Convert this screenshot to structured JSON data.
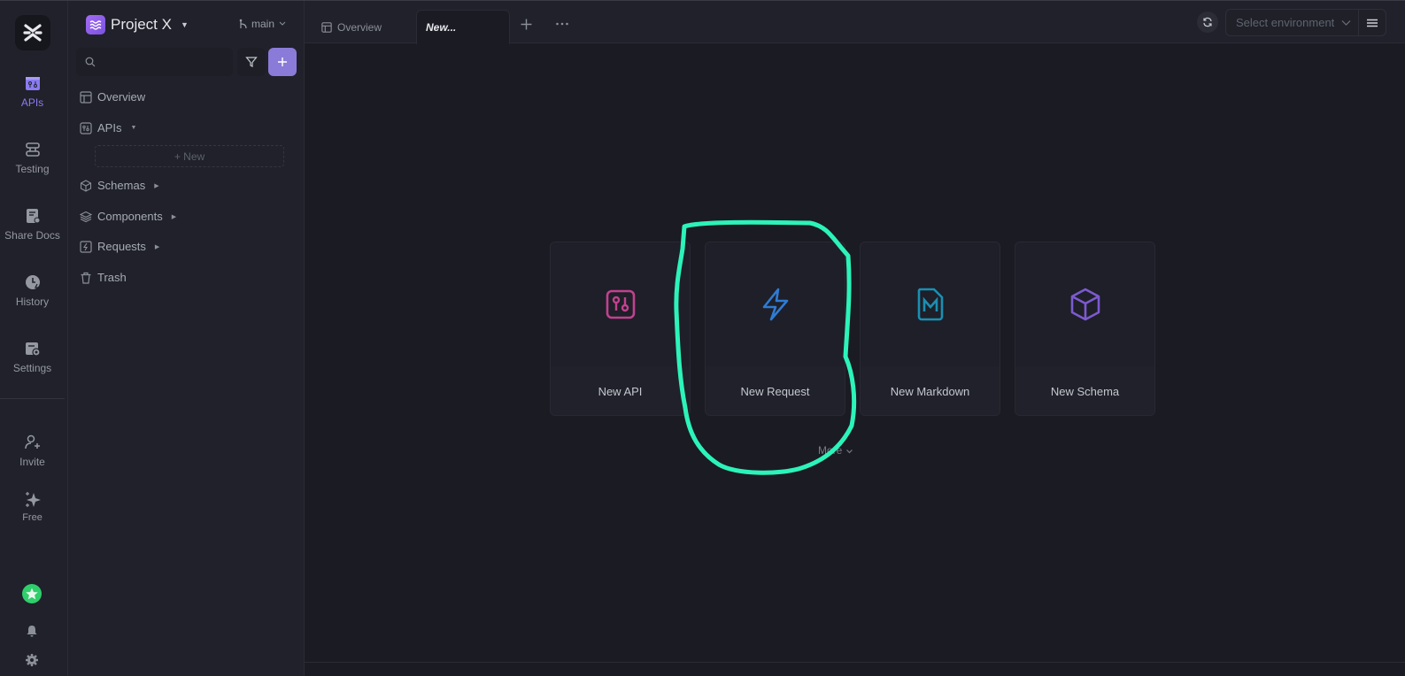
{
  "rail": {
    "items": [
      {
        "label": "APIs",
        "icon": "api-icon",
        "active": true
      },
      {
        "label": "Testing",
        "icon": "testing-icon"
      },
      {
        "label": "Share Docs",
        "icon": "share-docs-icon"
      },
      {
        "label": "History",
        "icon": "history-icon"
      },
      {
        "label": "Settings",
        "icon": "settings-icon"
      }
    ],
    "bottom": [
      {
        "label": "Invite",
        "icon": "invite-icon"
      },
      {
        "label": "Free",
        "icon": "sparkle-icon"
      }
    ]
  },
  "sidebar": {
    "project_name": "Project X",
    "branch": "main",
    "search": {
      "placeholder": "",
      "value": ""
    },
    "tree": [
      {
        "label": "Overview",
        "icon": "overview-icon"
      },
      {
        "label": "APIs",
        "icon": "api-icon",
        "expanded": true
      },
      {
        "label": "Schemas",
        "icon": "schema-icon"
      },
      {
        "label": "Components",
        "icon": "components-icon"
      },
      {
        "label": "Requests",
        "icon": "requests-icon"
      },
      {
        "label": "Trash",
        "icon": "trash-icon"
      }
    ],
    "new_label": "+ New"
  },
  "tabs": [
    {
      "label": "Overview"
    },
    {
      "label": "New...",
      "active": true
    }
  ],
  "toolbar": {
    "env_placeholder": "Select environment"
  },
  "cards": [
    {
      "label": "New API",
      "color": "#c2418f"
    },
    {
      "label": "New Request",
      "color": "#2f7bd3"
    },
    {
      "label": "New Markdown",
      "color": "#1a8fb3"
    },
    {
      "label": "New Schema",
      "color": "#7c5ad0"
    }
  ],
  "more_label": "More",
  "colors": {
    "accent": "#8a7bd8",
    "annotation": "#2cf3b9"
  }
}
